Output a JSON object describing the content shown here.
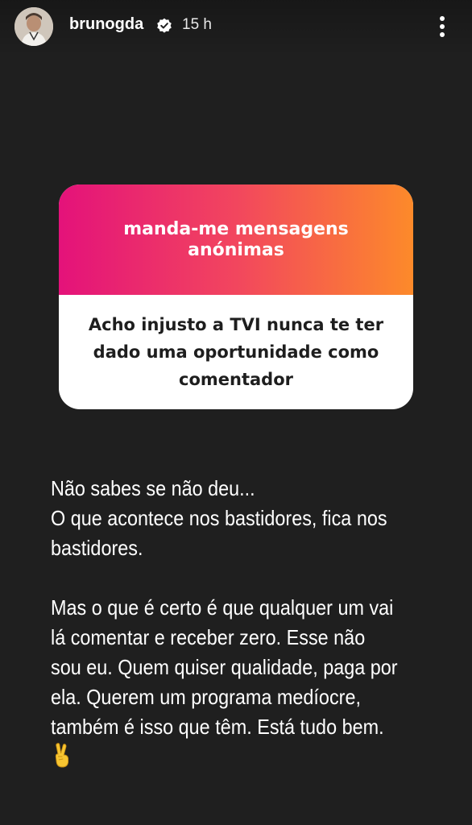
{
  "header": {
    "username": "brunogda",
    "time": "15 h",
    "verified_icon": "verified-badge-icon",
    "menu_icon": "more-options-icon"
  },
  "question_sticker": {
    "prompt": "manda-me mensagens anónimas",
    "answer": "Acho injusto a TVI nunca te ter dado uma oportunidade como comentador",
    "gradient_colors": [
      "#e4127a",
      "#f2465e",
      "#fd8a2a"
    ]
  },
  "reply": {
    "paragraph1": "Não sabes se não deu...\nO que acontece nos bastidores, fica nos bastidores.",
    "paragraph2": "Mas o que é certo é que qualquer um vai lá comentar e receber zero. Esse não sou eu. Quem quiser qualidade, paga por ela. Querem um programa medíocre, também é isso que têm. Está tudo bem.",
    "emoji": "victory-hand-icon"
  },
  "colors": {
    "background": "#1f1f1f",
    "text": "#ffffff",
    "answer_text": "#1e1e1e"
  }
}
